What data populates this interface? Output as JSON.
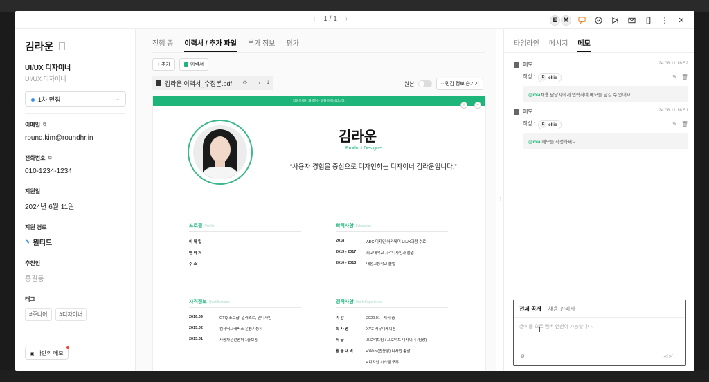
{
  "topbar": {
    "pager": "1 / 1",
    "prev": "‹",
    "next": "›",
    "avatars": [
      "E",
      "M"
    ],
    "icons": [
      "comment-icon",
      "check-circle-icon",
      "send-icon",
      "mail-icon",
      "mobile-icon",
      "more-icon",
      "close-icon"
    ]
  },
  "candidate": {
    "name": "김라운",
    "role": "UI/UX 디자이너",
    "role_sub": "UI/UX 디자이너",
    "stage": "1차 면접",
    "email_label": "이메일",
    "email": "round.kim@roundhr.in",
    "phone_label": "전화번호",
    "phone": "010-1234-1234",
    "applied_label": "지원일",
    "applied": "2024년 6월 11일",
    "channel_label": "지원 경로",
    "channel": "원티드",
    "referrer_label": "추천인",
    "referrer": "홍길동",
    "tags_label": "태그",
    "tags": [
      "#주니어",
      "#디자이너"
    ],
    "my_memo": "나만의 메모"
  },
  "center": {
    "tabs": [
      "진행 중",
      "이력서 / 추가 파일",
      "부가 정보",
      "평가"
    ],
    "add_label": "+ 추가",
    "resume_chip": "이력서",
    "file_name": "김라운 이력서_수정본.pdf",
    "original_label": "원본",
    "hide_label": "민감 정보 숨기기"
  },
  "resume": {
    "banner": "라운드에서 제공하는 샘플 이력서입니다.",
    "name": "김라운",
    "title": "Product Designer",
    "quote": "“사용자 경험을 중심으로 디자인하는 디자이너 김라운입니다.”",
    "profile": {
      "title": "프로필",
      "sub": "Profile",
      "rows": [
        "이 메 일",
        "연 락 처",
        "주 소"
      ]
    },
    "education": {
      "title": "학력사항",
      "sub": "Education",
      "rows": [
        {
          "k": "2018",
          "v": "ABC 디자인 아카데미 UIUX과정 수료"
        },
        {
          "k": "2013 - 2017",
          "v": "최고대학교 시각디자인과 졸업"
        },
        {
          "k": "2010 - 2013",
          "v": "대성고등학교 졸업"
        }
      ]
    },
    "qualifications": {
      "title": "자격정보",
      "sub": "Qualifications",
      "rows": [
        {
          "k": "2016.09",
          "v": "GTQ 포토샵, 일러스트, 인디자인"
        },
        {
          "k": "2015.02",
          "v": "컴퓨터그래픽스 운용기능사"
        },
        {
          "k": "2013.01",
          "v": "자동차운전면허 1종보통"
        }
      ]
    },
    "experience": {
      "title": "경력사항",
      "sub": "Work Experience",
      "rows": [
        {
          "k": "기 간",
          "v": "2020.01 - 재직 중"
        },
        {
          "k": "회 사 명",
          "v": "XYZ 커뮤니케이션"
        },
        {
          "k": "직 급",
          "v": "프로덕트팀 / 프로덕트 디자이너 (팀장)"
        },
        {
          "k": "활 동 내 역",
          "v": "• Web (반응형) 디자인 총괄"
        },
        {
          "k": "",
          "v": "• 디자인 시스템 구축"
        }
      ]
    }
  },
  "right": {
    "tabs": [
      "타임라인",
      "메시지",
      "메모"
    ],
    "memos": [
      {
        "title": "메모",
        "time": "24.06.11 16:52",
        "author_label": "작성 :",
        "author": "ellie",
        "mention": "@mia",
        "body": "채용 담당자에게 연락하여 메모를 남길 수 있어요."
      },
      {
        "title": "메모",
        "time": "24.06.11 16:51",
        "author_label": "작성 :",
        "author": "ellie",
        "mention": "@mia",
        "body": " 메모를 작성하세요."
      }
    ],
    "compose_tabs": [
      "전체 공개",
      "채용 관리자"
    ],
    "placeholder": "@이름 으로 멤버 언션이 가능합니다.",
    "save": "저장"
  }
}
